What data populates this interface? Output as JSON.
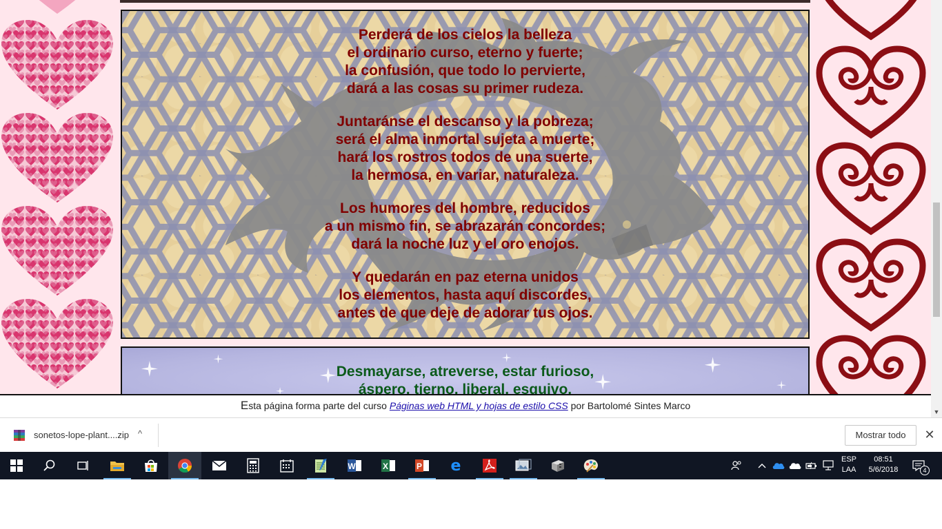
{
  "page": {
    "background_color": "#ffe9ee",
    "accent_heart_color": "#8b0e14",
    "poem_color": "#800000",
    "poem2_color": "#0b5a1a"
  },
  "sonnet": {
    "stanzas": [
      [
        "Perderá de los cielos la belleza",
        "el ordinario curso, eterno y fuerte;",
        "la confusión, que todo lo pervierte,",
        "dará a las cosas su primer rudeza."
      ],
      [
        "Juntaránse el descanso y la pobreza;",
        "será el alma inmortal sujeta a muerte;",
        "hará los rostros todos de una suerte,",
        "la hermosa, en variar, naturaleza."
      ],
      [
        "Los humores del hombre, reducidos",
        "a un mismo fin, se abrazarán concordes;",
        "dará la noche luz y el oro enojos."
      ],
      [
        "Y quedarán en paz eterna unidos",
        "los elementos, hasta aquí discordes,",
        "antes de que deje de adorar tus ojos."
      ]
    ]
  },
  "sonnet2": {
    "lines": [
      "Desmayarse, atreverse, estar furioso,",
      "áspero, tierno, liberal, esquivo,"
    ]
  },
  "footer": {
    "cap_letter": "E",
    "text_before": "sta página forma parte del curso ",
    "link_text": "Páginas web HTML y hojas de estilo CSS",
    "text_after": " por Bartolomé Sintes Marco"
  },
  "download_bar": {
    "file_name": "sonetos-lope-plant....zip",
    "caret": "^",
    "show_all_label": "Mostrar todo",
    "close_glyph": "✕"
  },
  "taskbar": {
    "apps": [
      {
        "name": "start-button",
        "icon": "windows-icon"
      },
      {
        "name": "search-button",
        "icon": "search-icon"
      },
      {
        "name": "task-view-button",
        "icon": "task-view-icon"
      },
      {
        "name": "file-explorer",
        "icon": "folder-icon"
      },
      {
        "name": "store",
        "icon": "store-icon"
      },
      {
        "name": "chrome",
        "icon": "chrome-icon"
      },
      {
        "name": "mail",
        "icon": "mail-icon"
      },
      {
        "name": "calculator",
        "icon": "calculator-icon"
      },
      {
        "name": "calendar",
        "icon": "calendar-icon"
      },
      {
        "name": "notepad",
        "icon": "notepad-icon"
      },
      {
        "name": "word",
        "icon": "word-icon",
        "letter": "W"
      },
      {
        "name": "excel",
        "icon": "excel-icon",
        "letter": "X"
      },
      {
        "name": "powerpoint",
        "icon": "powerpoint-icon",
        "letter": "P"
      },
      {
        "name": "edge",
        "icon": "edge-icon",
        "letter": "e"
      },
      {
        "name": "acrobat",
        "icon": "acrobat-icon"
      },
      {
        "name": "image-viewer",
        "icon": "image-viewer-icon"
      },
      {
        "name": "app-cube",
        "icon": "cube-icon"
      },
      {
        "name": "paint",
        "icon": "paint-icon"
      }
    ],
    "lang_top": "ESP",
    "lang_bottom": "LAA",
    "time": "08:51",
    "date": "5/6/2018",
    "notification_count": "4"
  }
}
